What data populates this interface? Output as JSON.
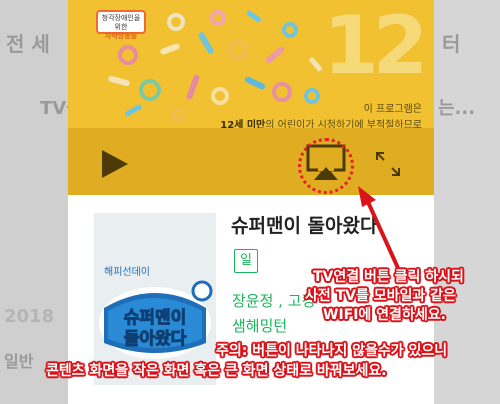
{
  "background": {
    "ghost_left_1": "전 세",
    "ghost_left_2": "TV를",
    "ghost_left_3": "2018",
    "ghost_left_4": "일반",
    "ghost_right_1": "는...",
    "ghost_right_2": "터"
  },
  "player": {
    "badge_line1": "청각장애인을 위한",
    "badge_line2": "자막방송중",
    "age_number": "12",
    "rating_line1": "이 프로그램은",
    "rating_line2_bold": "12세 미만",
    "rating_line2_rest": "의 어린이가 시청하기에 부적절하므로"
  },
  "show": {
    "poster_logo_small": "해피선데이",
    "poster_title_line1": "슈퍼맨이",
    "poster_title_line2": "돌아왔다",
    "title": "슈퍼맨이 돌아왔다",
    "day_tag": "일",
    "cast_line1": "장윤정 , 고경",
    "cast_line2": "샘해밍턴"
  },
  "annotation": {
    "line1": "TV연결 버튼 클릭 하시되",
    "line2": "사전 TV를 모바일과 같은",
    "line3": "WIFI에 연결하세요.",
    "line4": "주의: 버튼이 나타나지 않을수가 있으니",
    "line5": "콘텐츠 화면을 작은 화면 혹은 큰 화면 상태로 바꿔보세요."
  },
  "colors": {
    "player_yellow": "#f1c131",
    "controls_bar": "#e0ad22",
    "accent_green": "#19b65b",
    "annotation_red": "#d8141a"
  },
  "icons": [
    "play-icon",
    "airplay-icon",
    "expand-icon",
    "arrow-icon"
  ]
}
